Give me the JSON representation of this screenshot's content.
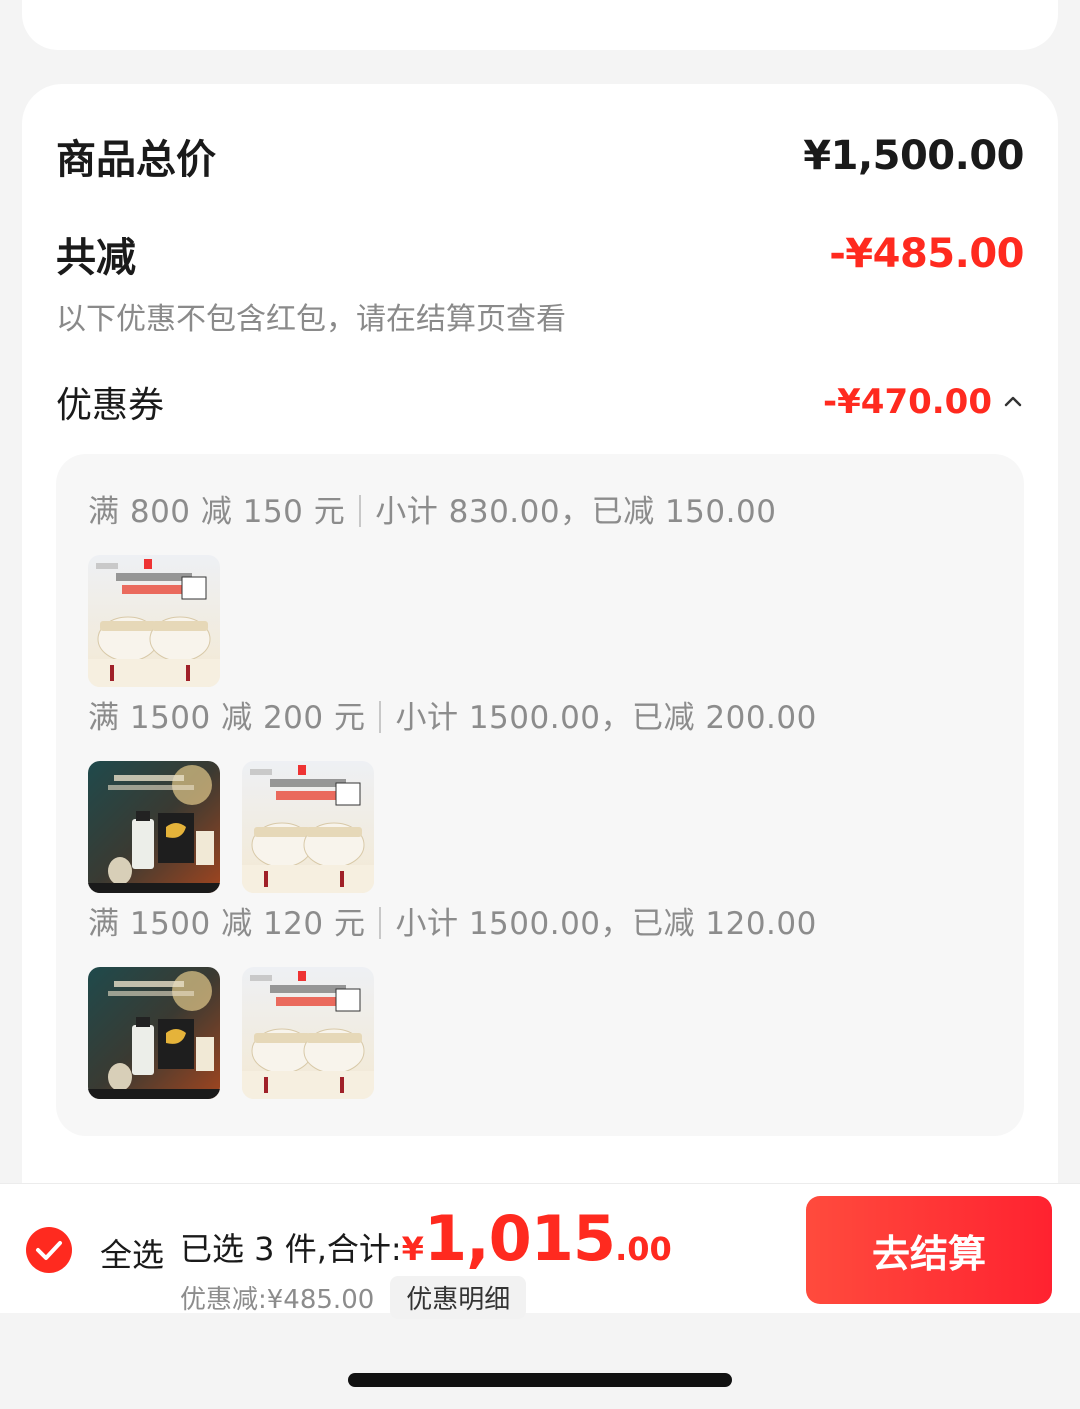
{
  "summary": {
    "total_label": "商品总价",
    "total_value": "¥1,500.00",
    "reduce_label": "共减",
    "reduce_value": "-¥485.00",
    "note": "以下优惠不包含红包，请在结算页查看",
    "coupon_label": "优惠券",
    "coupon_value": "-¥470.00"
  },
  "coupon_groups": [
    {
      "rule": "满 800 减 150 元",
      "detail": "小计 830.00，已减 150.00",
      "products": [
        "cream-set"
      ]
    },
    {
      "rule": "满 1500 减 200 元",
      "detail": "小计 1500.00，已减 200.00",
      "products": [
        "perfume-set",
        "cream-set"
      ]
    },
    {
      "rule": "满 1500 减 120 元",
      "detail": "小计 1500.00，已减 120.00",
      "products": [
        "perfume-set",
        "cream-set"
      ]
    }
  ],
  "bottom": {
    "select_all": "全选",
    "selected_text": "已选 3 件,合计:",
    "currency": "¥",
    "amount_int": "1,015",
    "amount_dec": ".00",
    "discount_text": "优惠减:¥485.00",
    "detail_chip": "优惠明细",
    "checkout": "去结算"
  },
  "colors": {
    "accent": "#ff2a1f",
    "background": "#f4f4f4"
  }
}
